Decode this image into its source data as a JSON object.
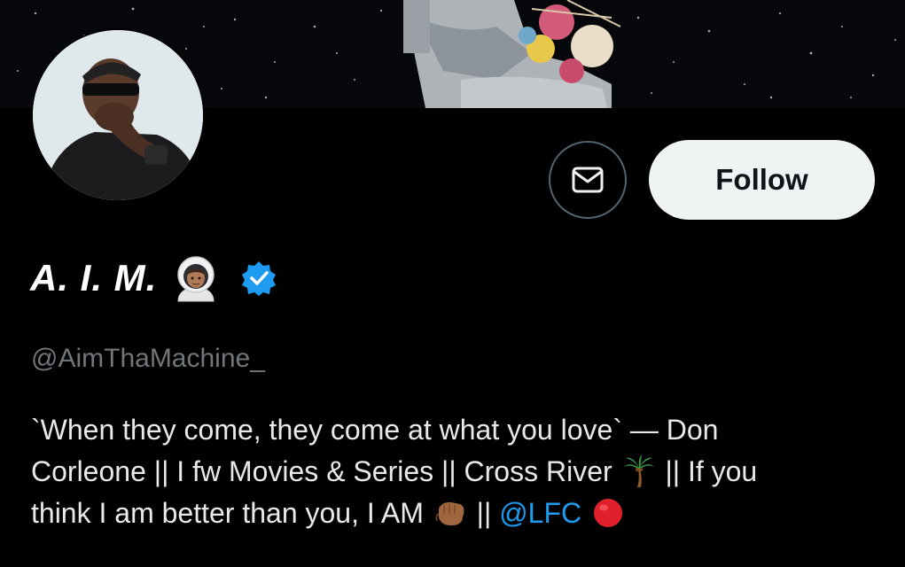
{
  "profile": {
    "display_name": "A. I. M.",
    "name_emoji": "astronaut-emoji",
    "verified_badge": "verified-check-icon",
    "handle": "@AimThaMachine_",
    "bio": {
      "line1": "`When they come, they come at what you love` — Don",
      "line2_a": "Corleone || I fw Movies & Series || Cross River",
      "line2_emoji": "palm-tree-emoji",
      "line2_b": "|| If you",
      "line3_a": "think I am better than you, I AM",
      "line3_emoji": "fist-bump-emoji",
      "line3_b": "||",
      "mention": "@LFC",
      "line3_end_emoji": "red-circle-emoji"
    }
  },
  "actions": {
    "message_icon": "envelope-icon",
    "follow_label": "Follow"
  },
  "colors": {
    "background": "#000000",
    "follow_bg": "#eff3f4",
    "handle": "#71767b",
    "mention": "#1d9bf0",
    "verified": "#1d9bf0",
    "button_border": "#536471"
  }
}
